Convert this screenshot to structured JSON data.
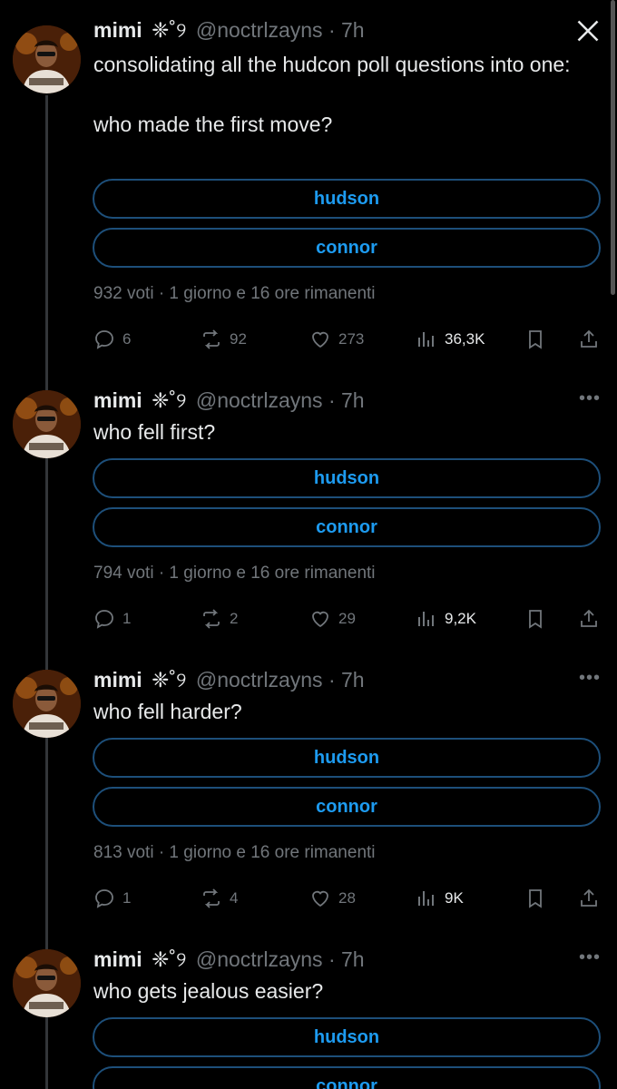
{
  "tweets": [
    {
      "name": "mimi",
      "emoji": "❈˚୨",
      "handle": "@noctrlzayns",
      "time": "· 7h",
      "text": "consolidating all the hudcon poll questions into one:\n\nwho made the first move?",
      "options": [
        "hudson",
        "connor"
      ],
      "poll_meta": "932 voti · 1 giorno e 16 ore rimanenti",
      "replies": "6",
      "reposts": "92",
      "likes": "273",
      "views": "36,3K"
    },
    {
      "name": "mimi",
      "emoji": "❈˚୨",
      "handle": "@noctrlzayns",
      "time": "· 7h",
      "text": "who fell first?",
      "options": [
        "hudson",
        "connor"
      ],
      "poll_meta": "794 voti · 1 giorno e 16 ore rimanenti",
      "replies": "1",
      "reposts": "2",
      "likes": "29",
      "views": "9,2K"
    },
    {
      "name": "mimi",
      "emoji": "❈˚୨",
      "handle": "@noctrlzayns",
      "time": "· 7h",
      "text": "who fell harder?",
      "options": [
        "hudson",
        "connor"
      ],
      "poll_meta": "813 voti · 1 giorno e 16 ore rimanenti",
      "replies": "1",
      "reposts": "4",
      "likes": "28",
      "views": "9K"
    },
    {
      "name": "mimi",
      "emoji": "❈˚୨",
      "handle": "@noctrlzayns",
      "time": "· 7h",
      "text": "who gets jealous easier?",
      "options": [
        "hudson",
        "connor"
      ]
    }
  ],
  "more_label": "•••",
  "icons": {
    "reply": "reply-icon",
    "repost": "repost-icon",
    "like": "heart-icon",
    "views": "views-icon",
    "bookmark": "bookmark-icon",
    "share": "share-icon",
    "close": "x-logo-icon"
  },
  "colors": {
    "background": "#000000",
    "accent": "#1d9bf0",
    "poll_border": "#1d4f7a",
    "muted": "#71767b"
  }
}
